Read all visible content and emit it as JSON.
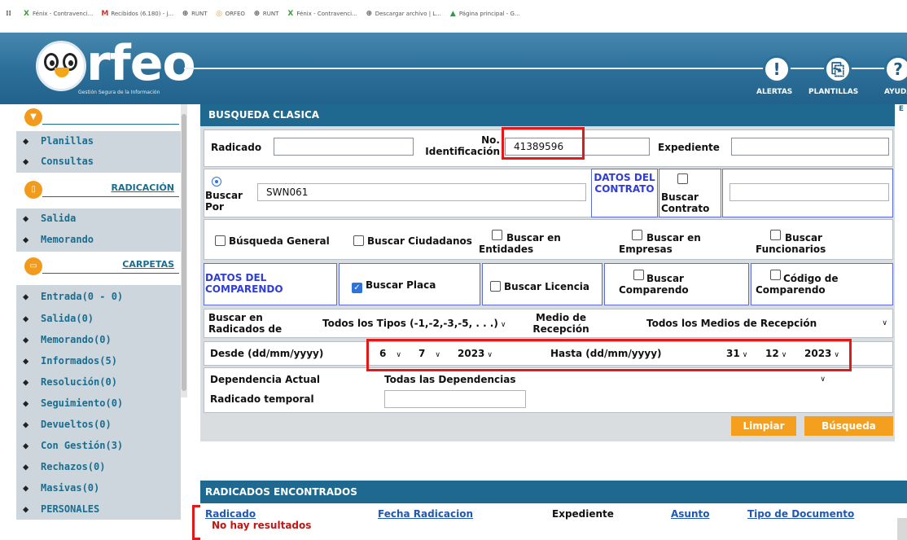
{
  "bookmarks": [
    {
      "icon": "apps-grid-icon",
      "label": ""
    },
    {
      "icon": "x-logo-icon",
      "label": "Fénix - Contravenci..."
    },
    {
      "icon": "gmail-icon",
      "label": "Recibidos (6.180) - j..."
    },
    {
      "icon": "globe-icon",
      "label": "RUNT"
    },
    {
      "icon": "orfeo-icon",
      "label": "ORFEO"
    },
    {
      "icon": "globe-icon",
      "label": "RUNT"
    },
    {
      "icon": "x-logo-icon",
      "label": "Fénix - Contravenci..."
    },
    {
      "icon": "globe-icon",
      "label": "Descargar archivo | L..."
    },
    {
      "icon": "drive-icon",
      "label": "Página principal - G..."
    }
  ],
  "header": {
    "logo_text": "rfeo",
    "tagline": "Gestión Segura de la Información",
    "actions": [
      {
        "label": "ALERTAS",
        "icon": "alert-icon",
        "glyph": "!"
      },
      {
        "label": "PLANTILLAS",
        "icon": "templates-icon",
        "glyph": "⎘"
      },
      {
        "label": "AYUDA",
        "icon": "help-icon",
        "glyph": "?"
      }
    ]
  },
  "sidebar": {
    "group1": [
      "Planillas",
      "Consultas"
    ],
    "radicacion_title": "RADICACIÓN",
    "group2": [
      "Salida",
      "Memorando"
    ],
    "carpetas_title": "CARPETAS",
    "folders": [
      "Entrada(0 - 0)",
      "Salida(0)",
      "Memorando(0)",
      "Informados(5)",
      "Resolución(0)",
      "Seguimiento(0)",
      "Devueltos(0)",
      "Con Gestión(3)",
      "Rechazos(0)",
      "Masivas(0)",
      "PERSONALES"
    ]
  },
  "search": {
    "title": "BUSQUEDA CLASICA",
    "right_edge": "E",
    "radicado_label": "Radicado",
    "radicado_value": "",
    "no_ident_label": "No. Identificación",
    "no_ident_value": "41389596",
    "expediente_label": "Expediente",
    "expediente_value": "",
    "buscar_por_label": "Buscar Por",
    "buscar_por_value": "SWN061",
    "datos_contrato": "DATOS DEL CONTRATO",
    "buscar_contrato": "Buscar Contrato",
    "contrato_value": "",
    "busqueda_general": "Búsqueda General",
    "buscar_ciudadanos": "Buscar Ciudadanos",
    "buscar_entidades": "Buscar en Entidades",
    "buscar_empresas": "Buscar en Empresas",
    "buscar_funcionarios": "Buscar Funcionarios",
    "datos_comparendo": "DATOS DEL COMPARENDO",
    "buscar_placa": "Buscar Placa",
    "buscar_licencia": "Buscar Licencia",
    "buscar_comparendo": "Buscar Comparendo",
    "codigo_comparendo": "Código de Comparendo",
    "buscar_en_radicados": "Buscar en Radicados de",
    "tipos_value": "Todos los Tipos (-1,-2,-3,-5, . . .)",
    "medio_recepcion": "Medio de Recepción",
    "medios_value": "Todos los Medios de Recepción",
    "desde_label": "Desde (dd/mm/yyyy)",
    "desde_day": "6",
    "desde_month": "7",
    "desde_year": "2023",
    "hasta_label": "Hasta (dd/mm/yyyy)",
    "hasta_day": "31",
    "hasta_month": "12",
    "hasta_year": "2023",
    "dependencia_label": "Dependencia Actual",
    "dependencia_value": "Todas las Dependencias",
    "radicado_temporal": "Radicado temporal",
    "radicado_temporal_value": "",
    "limpiar": "Limpiar",
    "busqueda": "Búsqueda"
  },
  "results": {
    "title": "RADICADOS ENCONTRADOS",
    "columns": [
      "Radicado",
      "Fecha Radicacion",
      "Expediente",
      "Asunto",
      "Tipo de Documento"
    ],
    "empty_message": "No hay resultados"
  },
  "colors": {
    "brand_blue": "#1f6890",
    "orange": "#f4a01e",
    "highlight_red": "#e11919"
  }
}
